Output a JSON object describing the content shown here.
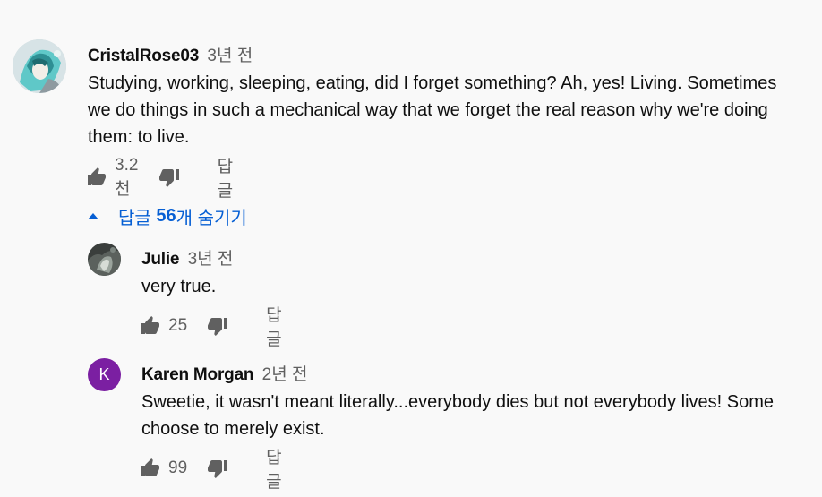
{
  "main_comment": {
    "author": "CristalRose03",
    "time": "3년 전",
    "text_lines": [
      "Studying, working, sleeping, eating, did I forget something? Ah, yes! Living. Sometimes",
      "we do things in such a mechanical way that we forget the real reason why we're doing",
      "them: to live."
    ],
    "likes": "3.2천",
    "reply_label": "답글"
  },
  "replies_toggle": {
    "prefix": "답글 ",
    "count": "56",
    "suffix": "개 숨기기"
  },
  "replies": [
    {
      "author": "Julie",
      "time": "3년 전",
      "text_lines": [
        "very true."
      ],
      "likes": "25",
      "reply_label": "답글"
    },
    {
      "author": "Karen Morgan",
      "time": "2년 전",
      "avatar_letter": "K",
      "avatar_color": "#7b1fa2",
      "text_lines": [
        "Sweetie, it wasn't meant literally...everybody dies but not everybody lives! Some",
        "choose to merely exist."
      ],
      "likes": "99",
      "reply_label": "답글"
    }
  ]
}
